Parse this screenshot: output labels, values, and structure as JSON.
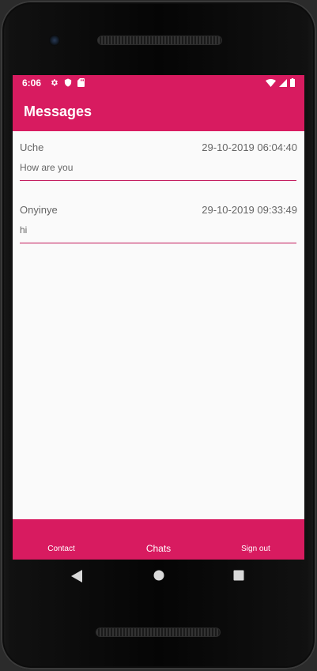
{
  "status_bar": {
    "time": "6:06",
    "left_icons": [
      "gear-icon",
      "shield-icon",
      "sd-card-icon"
    ],
    "right_icons": [
      "wifi-icon",
      "signal-icon",
      "battery-icon"
    ]
  },
  "app_bar": {
    "title": "Messages"
  },
  "messages": [
    {
      "sender": "Uche",
      "timestamp": "29-10-2019 06:04:40",
      "text": "How are you"
    },
    {
      "sender": "Onyinye",
      "timestamp": "29-10-2019 09:33:49",
      "text": "hi"
    }
  ],
  "bottom_nav": {
    "items": [
      {
        "label": "Contact"
      },
      {
        "label": "Chats"
      },
      {
        "label": "Sign out"
      }
    ]
  },
  "system_nav": {
    "buttons": [
      "back-triangle-icon",
      "home-circle-icon",
      "recents-square-icon"
    ]
  },
  "colors": {
    "primary": "#d81b60",
    "divider": "#c2185b",
    "background": "#fafafa",
    "secondary_text": "#666666"
  }
}
